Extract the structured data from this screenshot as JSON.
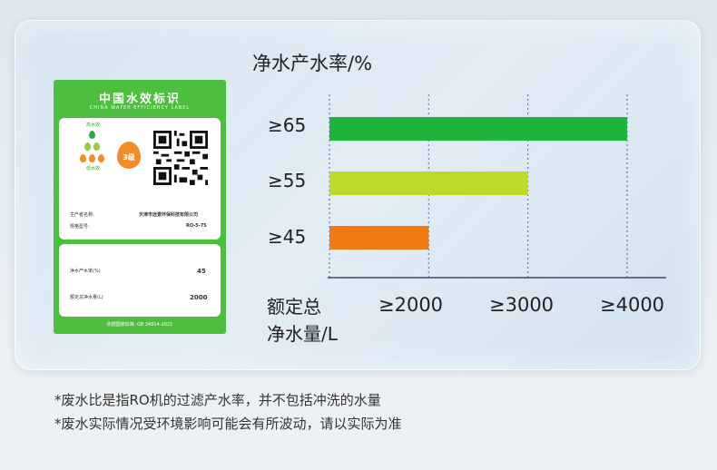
{
  "chart_data": {
    "type": "bar",
    "orientation": "horizontal",
    "title": "净水产水率/%",
    "categories": [
      "≥65",
      "≥55",
      "≥45"
    ],
    "values": [
      4000,
      3000,
      2000
    ],
    "xlabel": [
      "额定总",
      "净水量/L"
    ],
    "xticks": [
      "≥2000",
      "≥3000",
      "≥4000"
    ],
    "xlim": [
      1000,
      4000
    ],
    "grid": "dashed vertical",
    "colors": [
      "#1db53c",
      "#bfd92a",
      "#f07a12"
    ]
  },
  "label_card": {
    "title": "中国水效标识",
    "subtitle": "CHINA WATER EFFICIENCY LABEL",
    "grade": "3",
    "grade_suffix": "级",
    "top_scale_text": "高水效",
    "bottom_scale_text": "低水效",
    "producer_label": "生产者名称:",
    "producer_value": "天津市远景环保科技有限公司",
    "model_label": "规格型号:",
    "model_value": "RO-5-75",
    "rate_label": "净水产水率(%)",
    "rate_value": "45",
    "volume_label": "额定总净水量(L)",
    "volume_value": "2000",
    "footer": "依据国家标准: GB 34914-2021"
  },
  "notes": [
    "*废水比是指RO机的过滤产水率，并不包括冲洗的水量",
    "*废水实际情况受环境影响可能会有所波动，请以实际为准"
  ]
}
